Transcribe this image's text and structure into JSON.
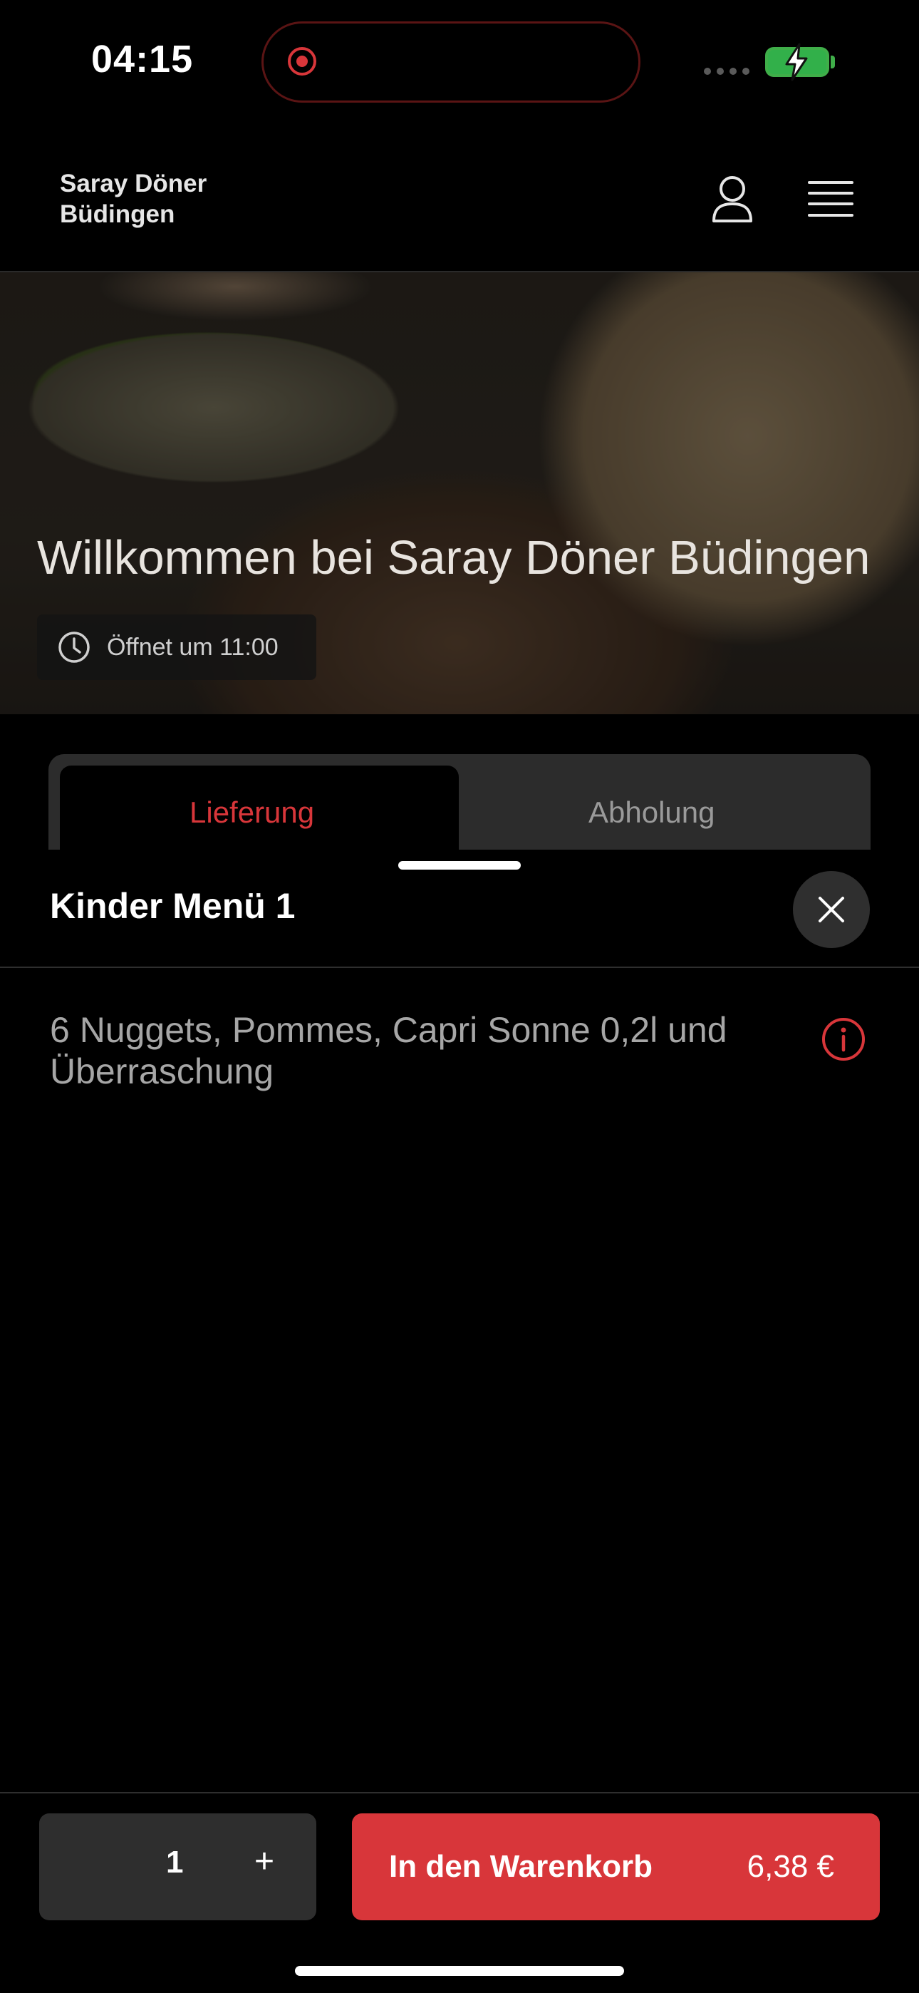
{
  "status_bar": {
    "time": "04:15"
  },
  "header": {
    "brand": "Saray Döner Büdingen"
  },
  "hero": {
    "title": "Willkommen bei Saray Döner Büdingen",
    "opening": "Öffnet um 11:00"
  },
  "tabs": [
    {
      "label": "Lieferung",
      "active": true
    },
    {
      "label": "Abholung",
      "active": false
    }
  ],
  "sheet": {
    "title": "Kinder Menü 1",
    "description": "6 Nuggets, Pommes, Capri Sonne 0,2l und Überraschung"
  },
  "order": {
    "quantity": "1",
    "plus": "+",
    "add_label": "In den Warenkorb",
    "price": "6,38 €"
  },
  "colors": {
    "accent": "#d8363a",
    "background": "#000000",
    "surface": "#2e2e2e"
  }
}
